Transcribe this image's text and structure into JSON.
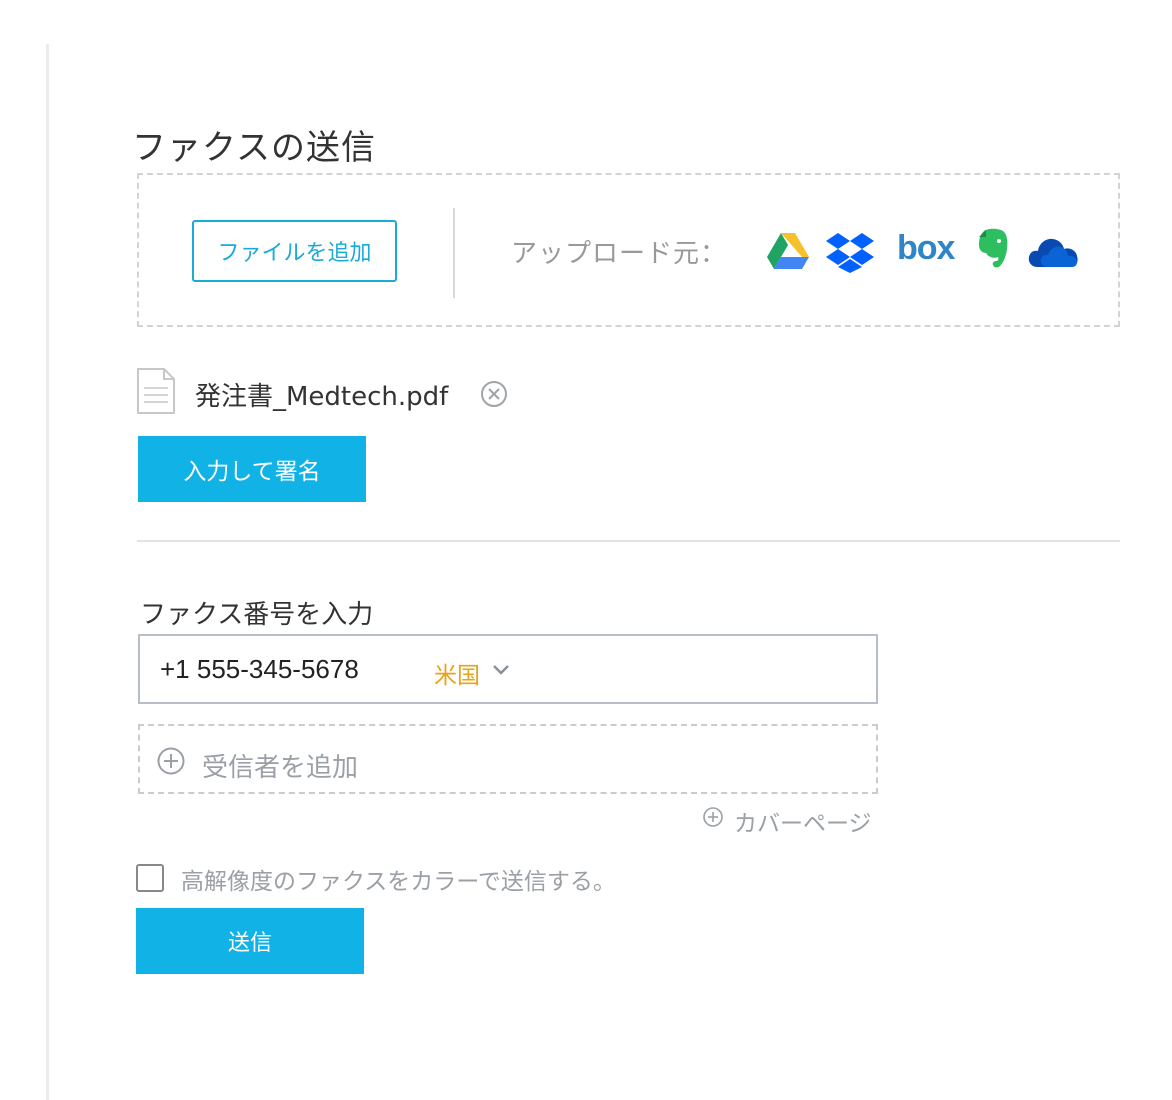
{
  "page": {
    "title": "ファクスの送信"
  },
  "upload": {
    "add_file_label": "ファイルを追加",
    "upload_from_label": "アップロード元：",
    "services": [
      {
        "name": "google-drive-icon"
      },
      {
        "name": "dropbox-icon"
      },
      {
        "name": "box-icon",
        "text": "box"
      },
      {
        "name": "evernote-icon"
      },
      {
        "name": "onedrive-icon"
      }
    ]
  },
  "file": {
    "name": "発注書_Medtech.pdf",
    "remove_icon": "close-circle-icon"
  },
  "sign_button_label": "入力して署名",
  "fax": {
    "label": "ファクス番号を入力",
    "number": "+1 555-345-5678",
    "country": "米国"
  },
  "recipient": {
    "add_label": "受信者を追加"
  },
  "cover_page_label": "カバーページ",
  "hd_option_label": "高解像度のファクスをカラーで送信する。",
  "send_button_label": "送信",
  "colors": {
    "accent": "#11b3e6",
    "country": "#e8a317",
    "muted": "#9aa0a6"
  }
}
